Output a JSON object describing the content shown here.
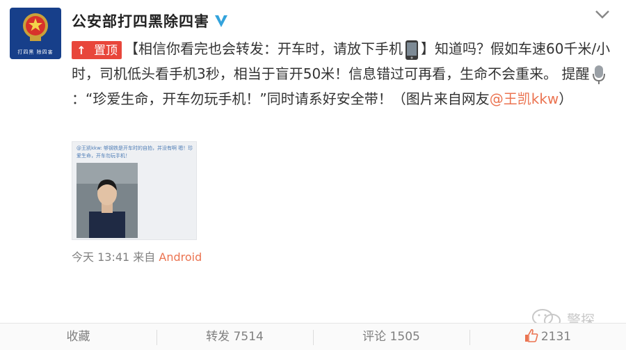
{
  "account": {
    "name": "公安部打四黑除四害",
    "avatar_caption": "打四黑 除四害"
  },
  "post": {
    "pinned_label": "置顶",
    "line1_before_emoji": "【相信你看完也会转发：开车时，请放下手机",
    "line1_after_emoji": "】知道吗？假如车速60千米/小时，司机低头看手机3秒，相当于盲开50米！信息错过可再看，生命不会重来。 提醒",
    "line2_after_mic": "：“珍爱生命，开车勿玩手机！”同时请系好安全带！（图片来自网友",
    "mention": "@王凯kkw",
    "line_end": "）",
    "image_caption": "@王凯kkw: 够钢铁是开车时的自拍，并没有啊 嗯！珍爱生命，开车勿玩手机！",
    "time": "今天 13:41",
    "from_label": "来自",
    "source": "Android"
  },
  "watermark": "警探",
  "actions": {
    "favorite": "收藏",
    "repost": "转发 7514",
    "comment": "评论 1505",
    "like": "2131"
  },
  "colors": {
    "accent": "#eb7350",
    "pin_red": "#e8463b",
    "verified_blue": "#33a3dc",
    "avatar_blue": "#173f8a"
  }
}
